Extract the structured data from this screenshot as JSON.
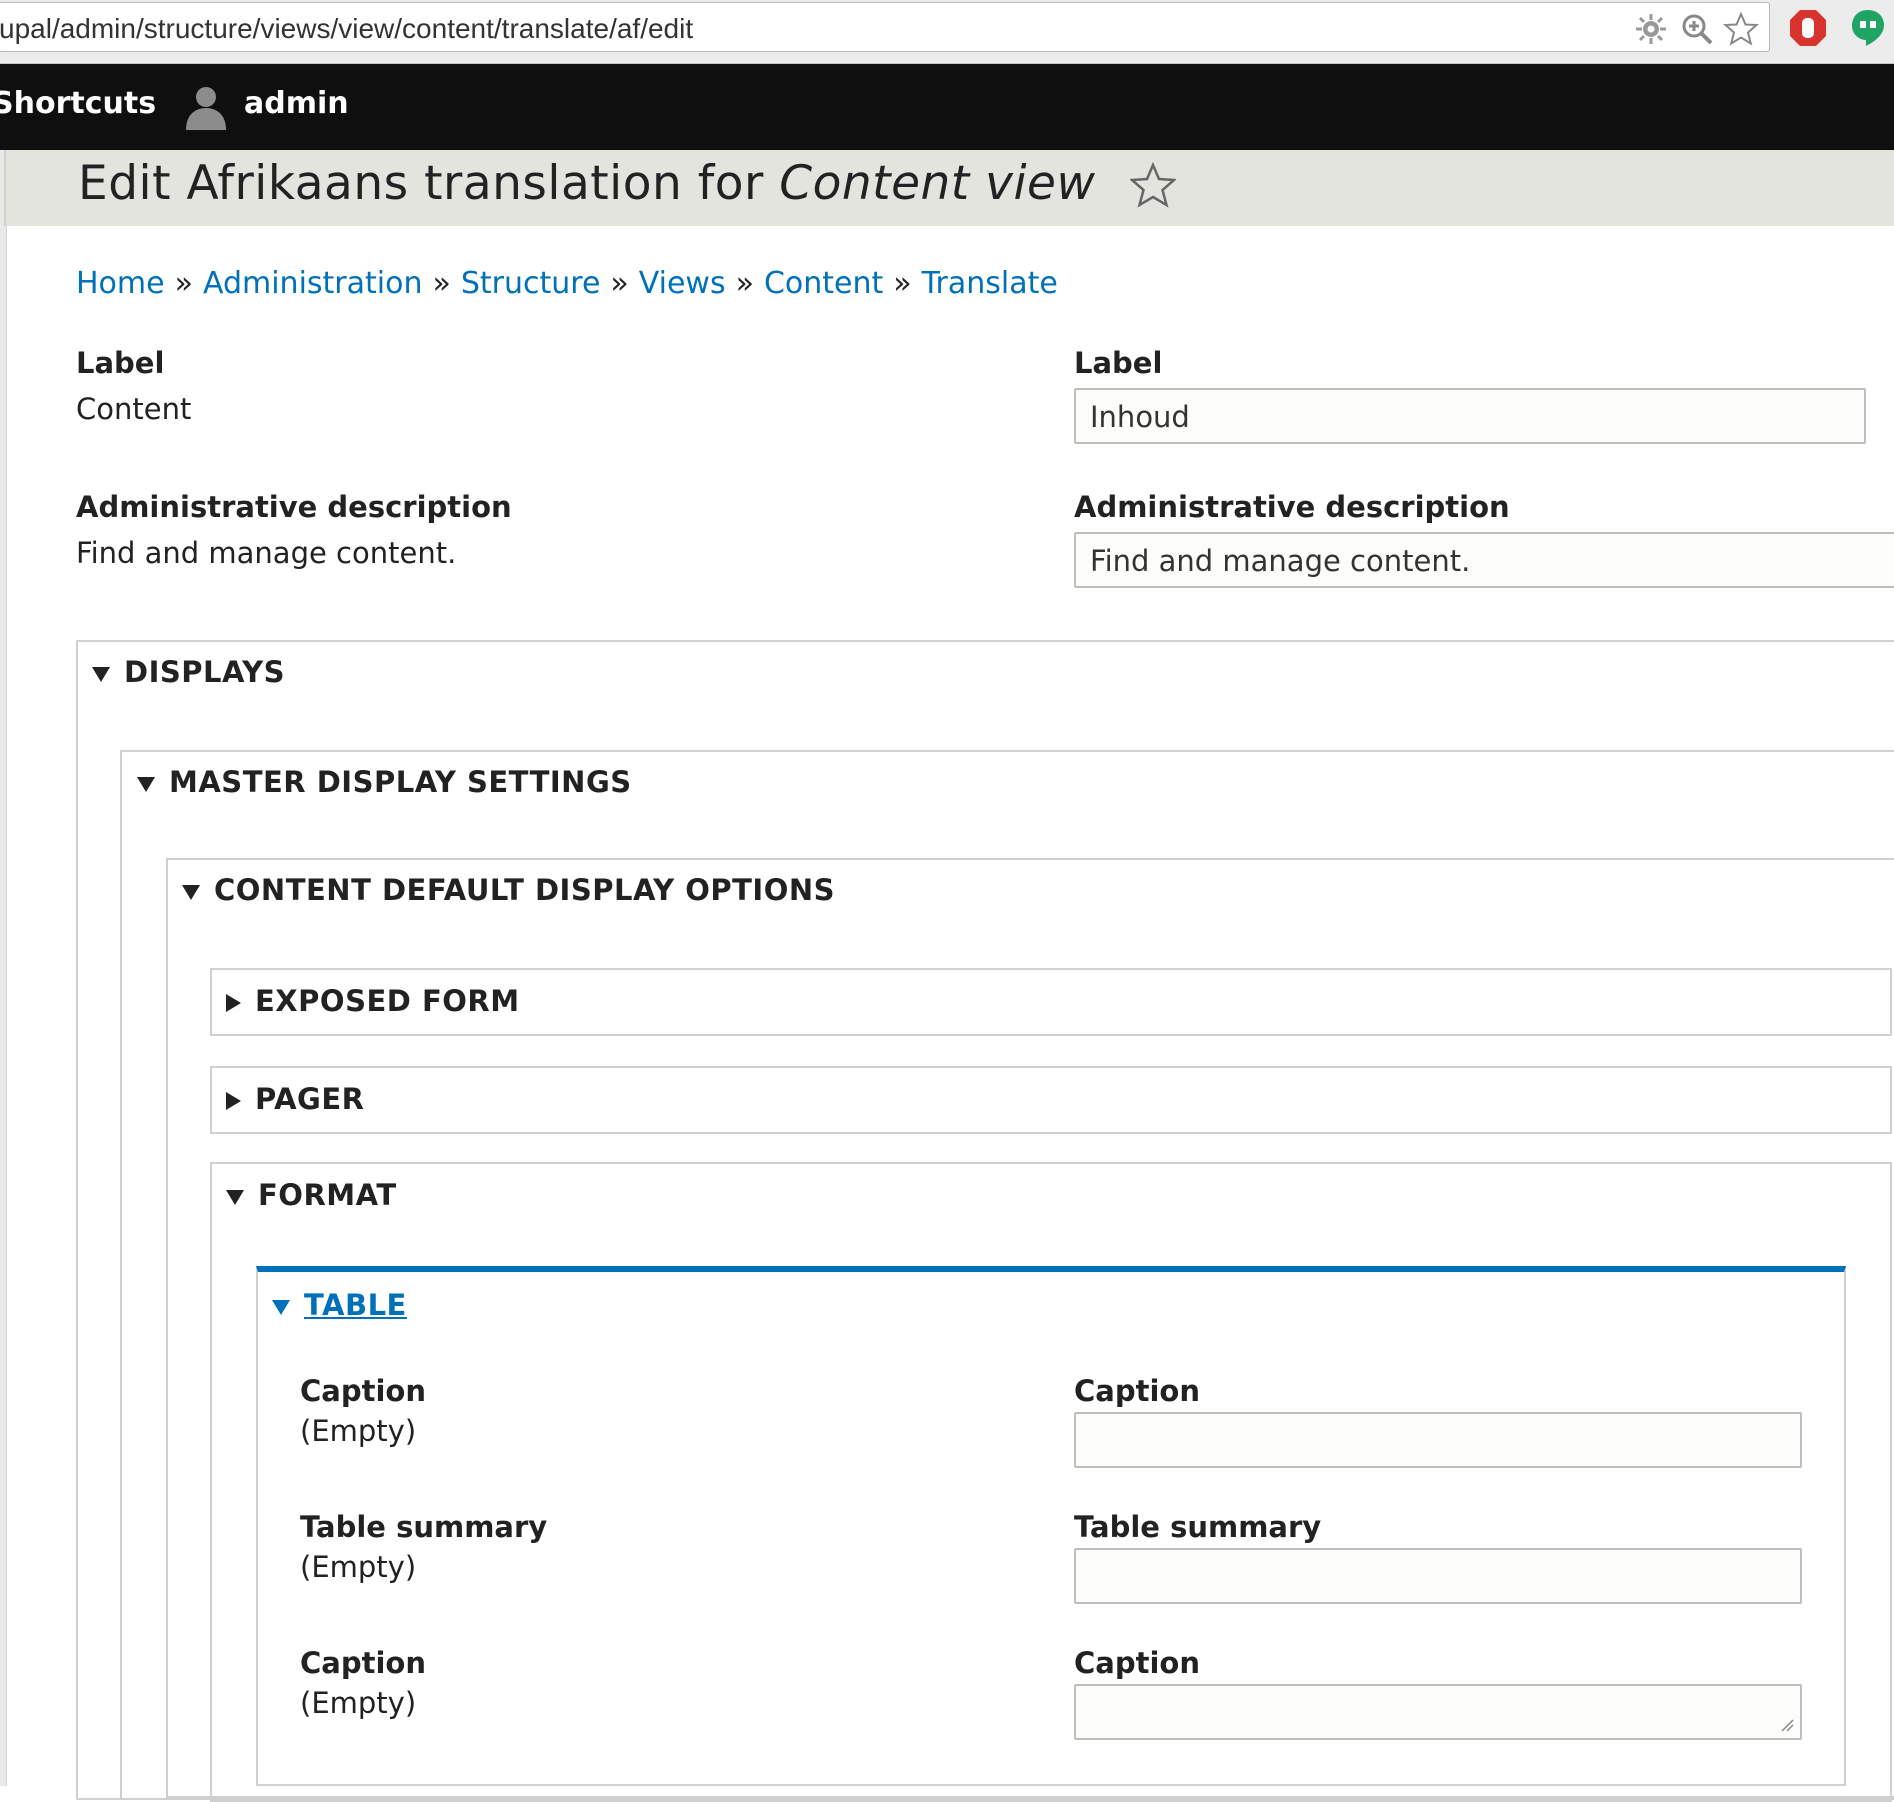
{
  "browser": {
    "url": "upal/admin/structure/views/view/content/translate/af/edit",
    "icons": [
      "settings-gear-icon",
      "zoom-icon",
      "bookmark-star-icon",
      "adblock-icon",
      "hangouts-icon"
    ]
  },
  "toolbar": {
    "shortcuts_label": "Shortcuts",
    "user_label": "admin"
  },
  "title": {
    "prefix": "Edit Afrikaans translation for ",
    "emphasis": "Content view"
  },
  "breadcrumb": {
    "items": [
      "Home",
      "Administration",
      "Structure",
      "Views",
      "Content",
      "Translate"
    ],
    "separator": "»"
  },
  "form": {
    "label": {
      "source_label": "Label",
      "source_value": "Content",
      "target_label": "Label",
      "target_value": "Inhoud"
    },
    "description": {
      "source_label": "Administrative description",
      "source_value": "Find and manage content.",
      "target_label": "Administrative description",
      "target_value": "Find and manage content."
    }
  },
  "sections": {
    "displays": "DISPLAYS",
    "master": "MASTER DISPLAY SETTINGS",
    "content_default": "CONTENT DEFAULT DISPLAY OPTIONS",
    "exposed_form": "EXPOSED FORM",
    "pager": "PAGER",
    "format": "FORMAT",
    "table": "TABLE"
  },
  "table_fields": [
    {
      "source_label": "Caption",
      "source_value": "(Empty)",
      "target_label": "Caption",
      "target_value": ""
    },
    {
      "source_label": "Table summary",
      "source_value": "(Empty)",
      "target_label": "Table summary",
      "target_value": ""
    },
    {
      "source_label": "Caption",
      "source_value": "(Empty)",
      "target_label": "Caption",
      "target_value": ""
    }
  ],
  "colors": {
    "link": "#0071b8",
    "toolbar_bg": "#0f0f0f",
    "title_bg": "#e4e4de"
  }
}
